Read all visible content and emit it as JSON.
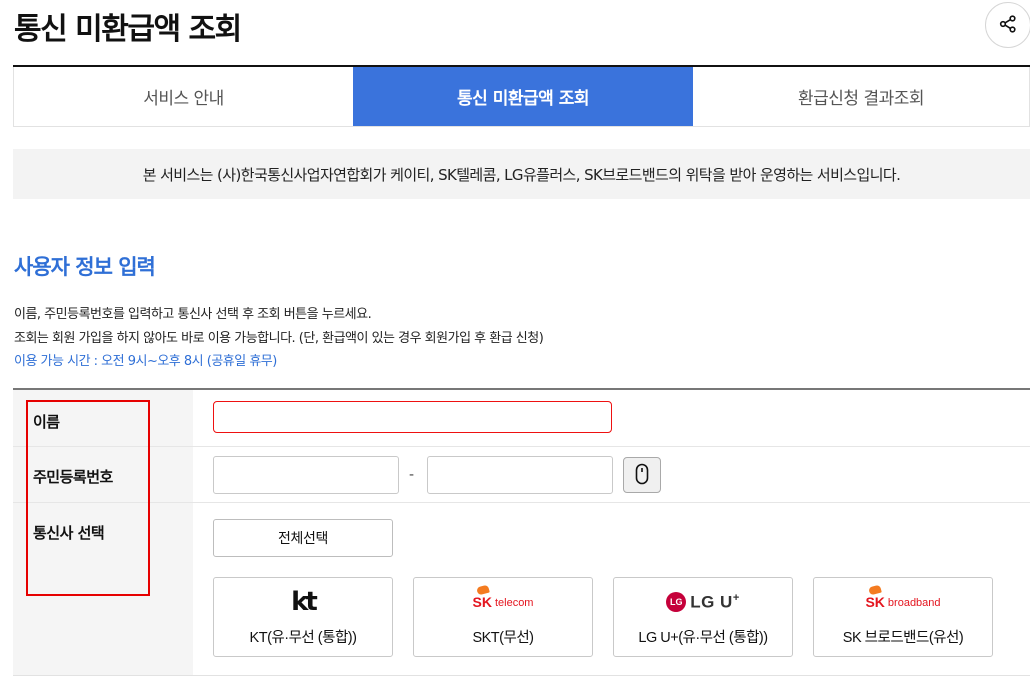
{
  "header": {
    "title": "통신 미환급액 조회",
    "share_icon": "share-icon"
  },
  "tabs": [
    {
      "label": "서비스 안내",
      "active": false
    },
    {
      "label": "통신 미환급액 조회",
      "active": true
    },
    {
      "label": "환급신청 결과조회",
      "active": false
    }
  ],
  "colors": {
    "accent": "#3a73dc",
    "section_title": "#2f6fd6",
    "error_border": "#e60000"
  },
  "notice": {
    "text": "본 서비스는 (사)한국통신사업자연합회가 케이티, SK텔레콤, LG유플러스, SK브로드밴드의 위탁을 받아 운영하는 서비스입니다."
  },
  "section": {
    "title": "사용자 정보 입력",
    "desc_1": "이름, 주민등록번호를 입력하고 통신사 선택 후 조회 버튼을 누르세요.",
    "desc_2": "조회는 회원 가입을 하지 않아도 바로 이용 가능합니다. (단, 환급액이 있는 경우 회원가입 후 환급 신청)",
    "hours": "이용 가능 시간 : 오전 9시~오후 8시 (공휴일 휴무)"
  },
  "form": {
    "name_label": "이름",
    "name_value": "",
    "rrn_label": "주민등록번호",
    "rrn_front_value": "",
    "rrn_back_value": "",
    "rrn_separator": "-",
    "keypad_icon": "keypad-icon",
    "carrier_label": "통신사 선택",
    "select_all_label": "전체선택",
    "carriers": [
      {
        "logo": "kt",
        "label": "KT(유·무선 (통합))"
      },
      {
        "logo_mark": "SK",
        "logo_word": "telecom",
        "label": "SKT(무선)"
      },
      {
        "logo_mark": "LG",
        "logo_text": "LG U",
        "logo_plus": "+",
        "label": "LG U+(유·무선 (통합))"
      },
      {
        "logo_mark": "SK",
        "logo_word": "broadband",
        "label": "SK 브로드밴드(유선)"
      }
    ]
  }
}
